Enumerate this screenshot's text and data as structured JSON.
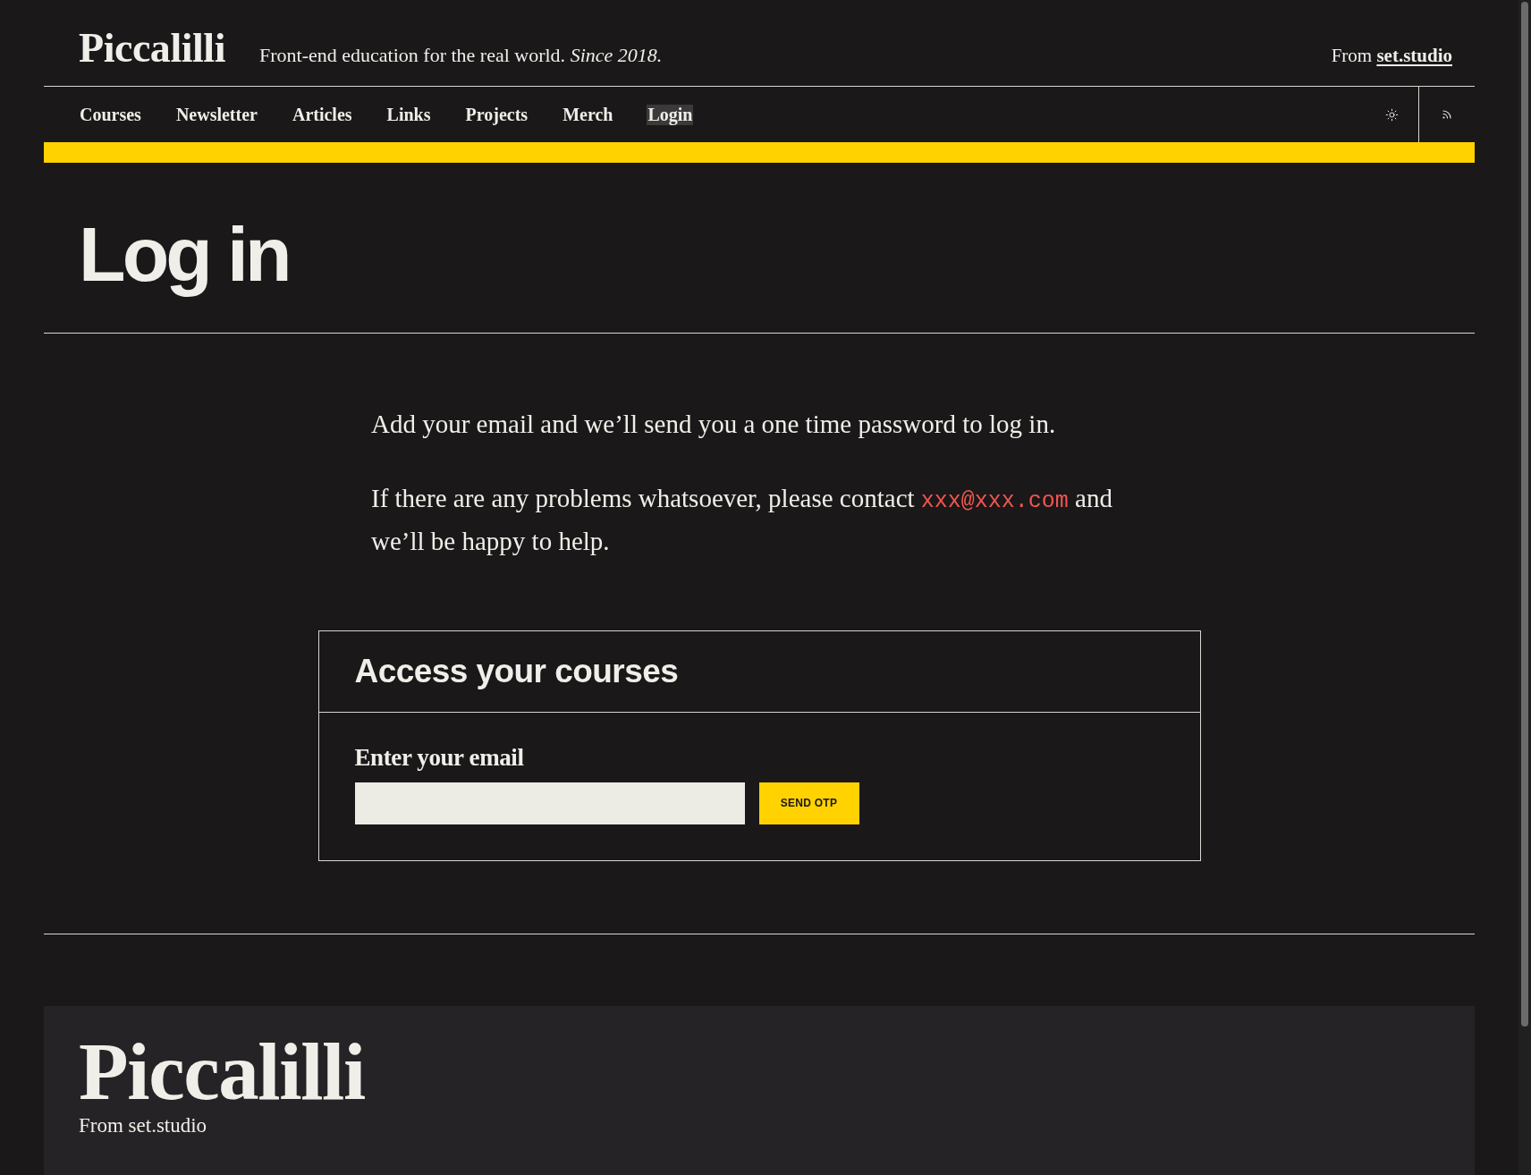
{
  "header": {
    "logo": "Piccalilli",
    "tagline": "Front-end education for the real world. *Since 2018.*",
    "attribution": {
      "text": "From",
      "link": "set.studio"
    }
  },
  "nav": {
    "items": [
      {
        "label": "Courses",
        "selected": false
      },
      {
        "label": "Newsletter",
        "selected": false
      },
      {
        "label": "Articles",
        "selected": false
      },
      {
        "label": "Links",
        "selected": false
      },
      {
        "label": "Projects",
        "selected": false
      },
      {
        "label": "Merch",
        "selected": false
      },
      {
        "label": "Login",
        "selected": true
      }
    ]
  },
  "page": {
    "title": "Log in"
  },
  "intro": {
    "lead": "Add your email and we’ll send you a one time password to log in.",
    "contact": {
      "before": "If there are any problems whatsoever, please contact",
      "email": "xxx@xxx.com",
      "after": "and we’ll be happy to help."
    }
  },
  "login_card": {
    "title": "Access your courses",
    "field": {
      "label": "Enter your email"
    },
    "button": "SEND OTP"
  },
  "footer": {
    "logo": "Piccalilli",
    "text": "From set.studio"
  }
}
